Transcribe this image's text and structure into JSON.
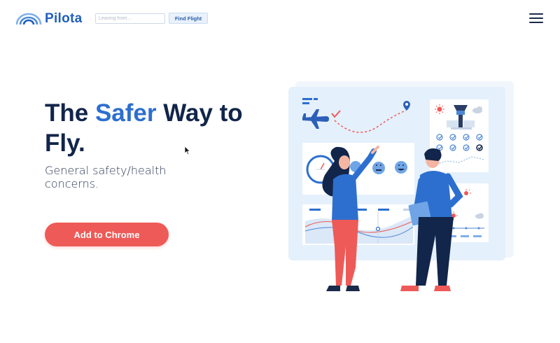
{
  "header": {
    "logo_text": "Pilota",
    "search_placeholder": "Leaving from...",
    "find_button_label": "Find Flight",
    "menu_icon": "hamburger-menu-icon"
  },
  "hero": {
    "headline_part1": "The ",
    "headline_accent": "Safer",
    "headline_part2": " Way to Fly.",
    "subtext": "General safety/health concerns.",
    "cta_label": "Add to Chrome"
  },
  "colors": {
    "brand": "#1f5fbf",
    "accent": "#2d6fcf",
    "headline": "#12254a",
    "cta": "#ee5a57"
  }
}
